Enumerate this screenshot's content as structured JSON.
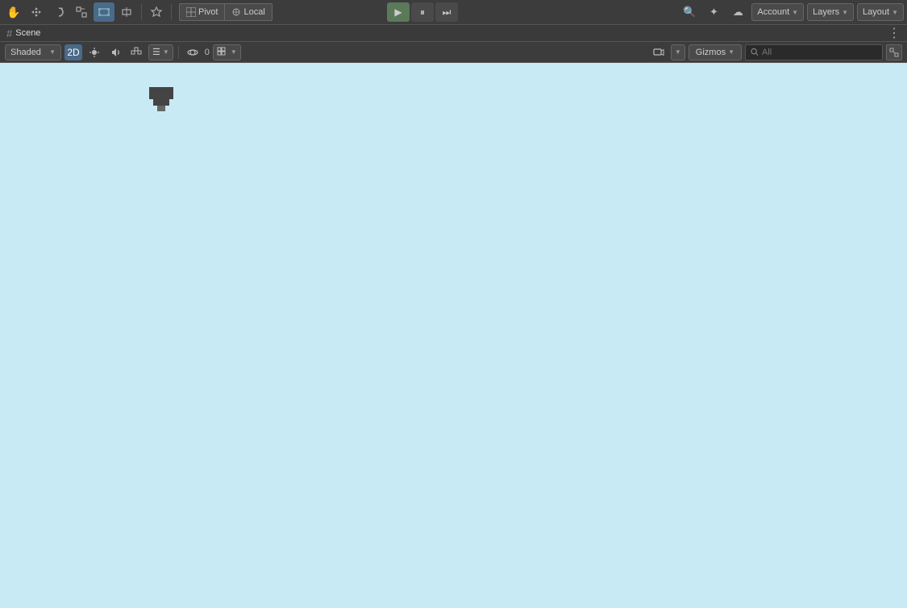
{
  "toolbar": {
    "pivot_label": "Pivot",
    "local_label": "Local",
    "account_label": "Account",
    "layers_label": "Layers",
    "layout_label": "Layout"
  },
  "scene": {
    "label": "Scene"
  },
  "view": {
    "shaded_label": "Shaded",
    "mode_2d": "2D",
    "layer_count": "0",
    "gizmos_label": "Gizmos",
    "search_placeholder": "All"
  }
}
